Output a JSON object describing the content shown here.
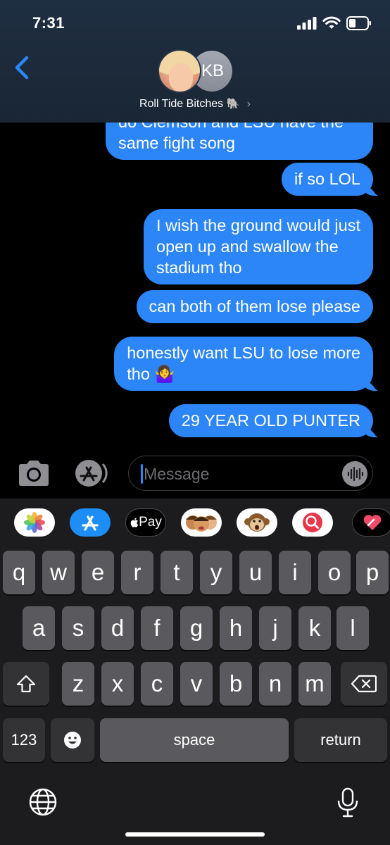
{
  "status_bar": {
    "time": "7:31"
  },
  "header": {
    "contact_initials": "KB",
    "group_name": "Roll Tide Bitches",
    "group_emoji": "🐘",
    "chevron": "›"
  },
  "messages": [
    {
      "text": "do Clemson and LSU have the\nsame fight song",
      "from": "me"
    },
    {
      "text": "if so LOL",
      "from": "me"
    },
    {
      "text": "I wish the ground would just\nopen up and swallow the\nstadium tho",
      "from": "me"
    },
    {
      "text": "can both of them lose please",
      "from": "me"
    },
    {
      "text": "honestly want LSU to lose more\ntho 🤷‍♀️",
      "from": "me"
    },
    {
      "text": "29 YEAR OLD PUNTER",
      "from": "me"
    }
  ],
  "input": {
    "placeholder": "iMessage",
    "value": ""
  },
  "app_drawer": {
    "items": [
      "photos-icon",
      "app-store-icon",
      "apple-pay",
      "memoji-stickers",
      "animoji",
      "web-search",
      "digital-touch"
    ],
    "apple_pay_label": "Pay"
  },
  "keyboard": {
    "row1": [
      "q",
      "w",
      "e",
      "r",
      "t",
      "y",
      "u",
      "i",
      "o",
      "p"
    ],
    "row2": [
      "a",
      "s",
      "d",
      "f",
      "g",
      "h",
      "j",
      "k",
      "l"
    ],
    "row3": [
      "z",
      "x",
      "c",
      "v",
      "b",
      "n",
      "m"
    ],
    "numbers_label": "123",
    "space_label": "space",
    "return_label": "return"
  },
  "colors": {
    "bubble_blue": "#2c86f7",
    "key_bg": "#5a5a5e",
    "key_dark_bg": "#333336",
    "keyboard_bg": "#1c1c1e",
    "header_bg": "#1f2f42"
  }
}
